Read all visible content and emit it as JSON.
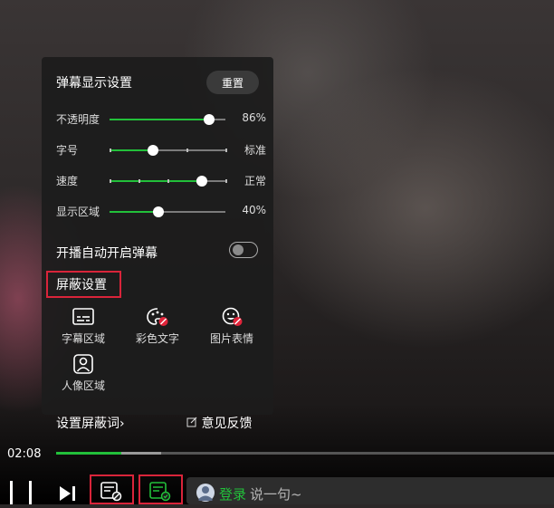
{
  "settings_panel": {
    "title": "弹幕显示设置",
    "reset_label": "重置",
    "sliders": [
      {
        "label": "不透明度",
        "value_text": "86%",
        "fraction": 0.86,
        "ticks": 0
      },
      {
        "label": "字号",
        "value_text": "标准",
        "fraction": 0.375,
        "ticks": 4
      },
      {
        "label": "速度",
        "value_text": "正常",
        "fraction": 0.8,
        "ticks": 5
      },
      {
        "label": "显示区域",
        "value_text": "40%",
        "fraction": 0.42,
        "ticks": 0
      }
    ],
    "auto_danmaku_label": "开播自动开启弹幕",
    "auto_danmaku_on": false,
    "block_section_title": "屏蔽设置",
    "block_options": [
      {
        "label": "字幕区域",
        "icon": "subtitle-area-icon"
      },
      {
        "label": "彩色文字",
        "icon": "color-text-icon"
      },
      {
        "label": "图片表情",
        "icon": "emoji-icon"
      },
      {
        "label": "人像区域",
        "icon": "portrait-area-icon"
      }
    ],
    "block_words_link": "设置屏蔽词",
    "block_words_chevron": "›",
    "feedback_label": "意见反馈"
  },
  "player": {
    "current_time": "02:08",
    "played_fraction": 0.13,
    "buffered_fraction": 0.21
  },
  "chat_input": {
    "login_label": "登录",
    "placeholder": "说一句~"
  },
  "colors": {
    "accent_green": "#22c03a",
    "highlight_red": "#d9243a",
    "panel_bg": "#1c1c1c"
  }
}
